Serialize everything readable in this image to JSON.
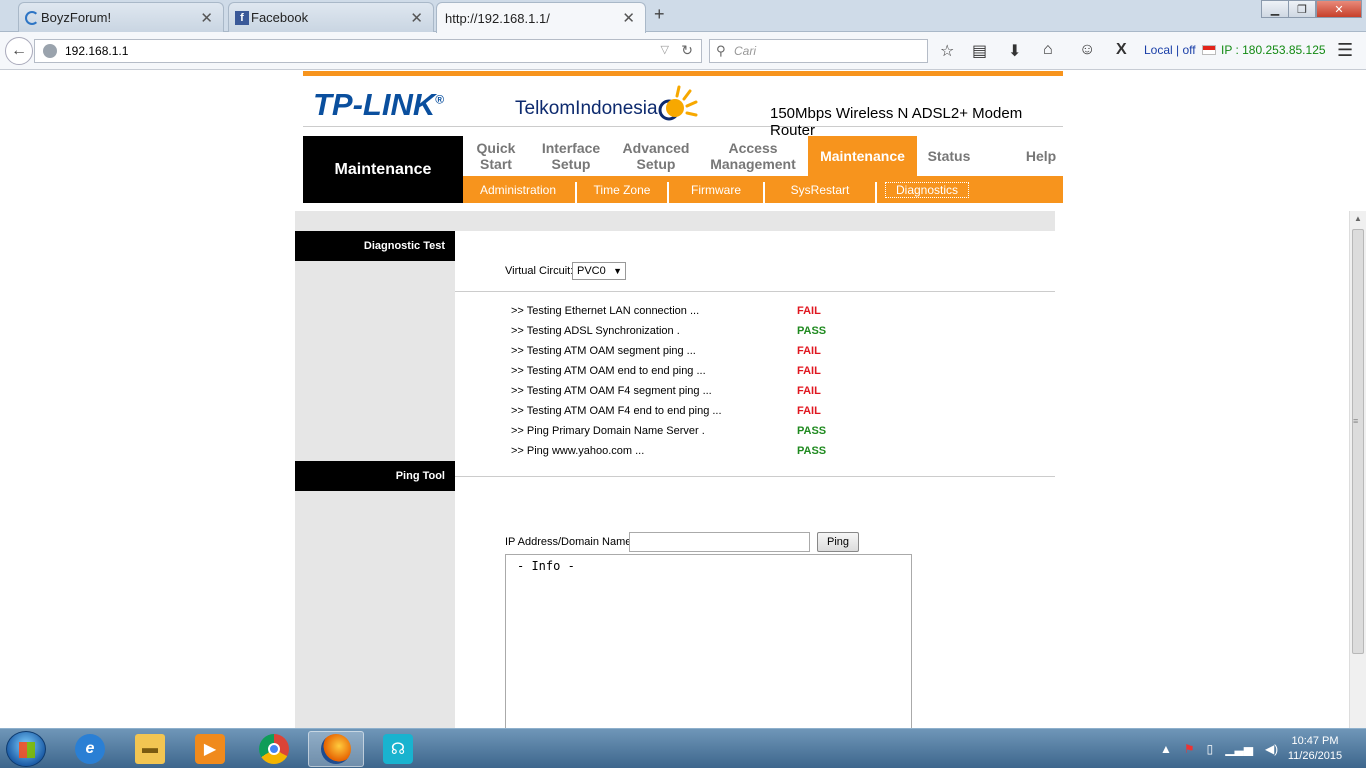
{
  "browser": {
    "tabs": [
      {
        "label": "BoyzForum!",
        "active": false
      },
      {
        "label": "Facebook",
        "active": false
      },
      {
        "label": "http://192.168.1.1/",
        "active": true
      }
    ],
    "url": "192.168.1.1",
    "search_placeholder": "Cari",
    "local_off": "Local | off",
    "ip_label": "IP : 180.253.85.125"
  },
  "router": {
    "brand_logo": "TP-LINK",
    "isp_logo": "TelkomIndonesia",
    "product_name": "150Mbps Wireless N ADSL2+ Modem Router",
    "section_title": "Maintenance",
    "menu": [
      {
        "label": "Quick Start"
      },
      {
        "label": "Interface Setup"
      },
      {
        "label": "Advanced Setup"
      },
      {
        "label": "Access Management"
      },
      {
        "label": "Maintenance"
      },
      {
        "label": "Status"
      },
      {
        "label": "Help"
      }
    ],
    "submenu": [
      {
        "label": "Administration"
      },
      {
        "label": "Time Zone"
      },
      {
        "label": "Firmware"
      },
      {
        "label": "SysRestart"
      },
      {
        "label": "Diagnostics"
      }
    ],
    "diagnostic_head": "Diagnostic Test",
    "vc_label": "Virtual Circuit:",
    "vc_value": "PVC0",
    "tests": [
      {
        "label": ">> Testing Ethernet LAN connection ...",
        "result": "FAIL"
      },
      {
        "label": ">> Testing ADSL Synchronization .",
        "result": "PASS"
      },
      {
        "label": ">> Testing ATM OAM segment ping ...",
        "result": "FAIL"
      },
      {
        "label": ">> Testing ATM OAM end to end ping ...",
        "result": "FAIL"
      },
      {
        "label": ">> Testing ATM OAM F4 segment ping ...",
        "result": "FAIL"
      },
      {
        "label": ">> Testing ATM OAM F4 end to end ping ...",
        "result": "FAIL"
      },
      {
        "label": ">> Ping Primary Domain Name Server .",
        "result": "PASS"
      },
      {
        "label": ">> Ping www.yahoo.com ...",
        "result": "PASS"
      }
    ],
    "ping_head": "Ping Tool",
    "ping_label": "IP Address/Domain Name:",
    "ping_input_value": "",
    "ping_button": "Ping",
    "info_text": "- Info -"
  },
  "taskbar": {
    "time": "10:47 PM",
    "date": "11/26/2015"
  }
}
